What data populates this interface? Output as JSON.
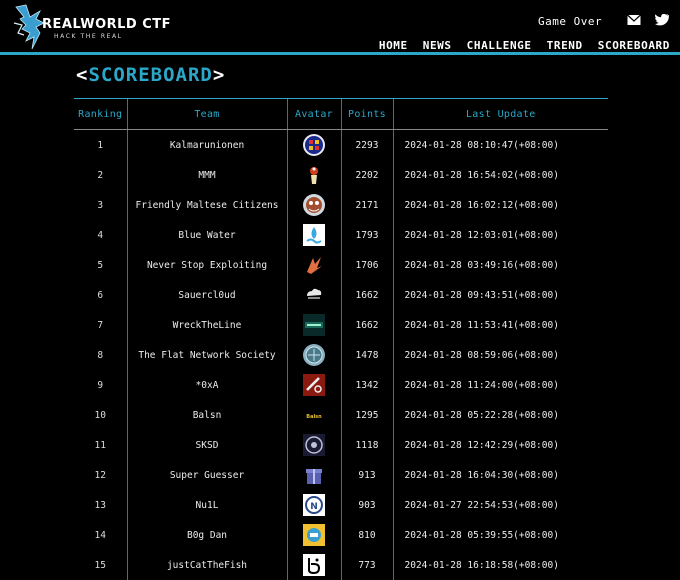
{
  "header": {
    "logo_title": "REALWORLD CTF",
    "logo_sub": "HACK THE REAL",
    "status": "Game Over",
    "icons": [
      "mail-icon",
      "twitter-icon"
    ],
    "nav": [
      {
        "label": "HOME"
      },
      {
        "label": "NEWS"
      },
      {
        "label": "CHALLENGE"
      },
      {
        "label": "TREND"
      },
      {
        "label": "SCOREBOARD"
      }
    ],
    "accent_color": "#2aa7c9"
  },
  "page": {
    "title_open": "<",
    "title": "SCOREBOARD",
    "title_close": ">"
  },
  "table": {
    "columns": [
      "Ranking",
      "Team",
      "Avatar",
      "Points",
      "Last Update"
    ],
    "rows": [
      {
        "rank": "1",
        "team": "Kalmarunionen",
        "avatar": "kalmarunionen-avatar",
        "points": "2293",
        "updated": "2024-01-28 08:10:47(+08:00)"
      },
      {
        "rank": "2",
        "team": "MMM",
        "avatar": "mmm-avatar",
        "points": "2202",
        "updated": "2024-01-28 16:54:02(+08:00)"
      },
      {
        "rank": "3",
        "team": "Friendly Maltese Citizens",
        "avatar": "fmc-avatar",
        "points": "2171",
        "updated": "2024-01-28 16:02:12(+08:00)"
      },
      {
        "rank": "4",
        "team": "Blue Water",
        "avatar": "blue-water-avatar",
        "points": "1793",
        "updated": "2024-01-28 12:03:01(+08:00)"
      },
      {
        "rank": "5",
        "team": "Never Stop Exploiting",
        "avatar": "nse-avatar",
        "points": "1706",
        "updated": "2024-01-28 03:49:16(+08:00)"
      },
      {
        "rank": "6",
        "team": "Sauercl0ud",
        "avatar": "sauercloud-avatar",
        "points": "1662",
        "updated": "2024-01-28 09:43:51(+08:00)"
      },
      {
        "rank": "7",
        "team": "WreckTheLine",
        "avatar": "wrecktheline-avatar",
        "points": "1662",
        "updated": "2024-01-28 11:53:41(+08:00)"
      },
      {
        "rank": "8",
        "team": "The Flat Network Society",
        "avatar": "tfns-avatar",
        "points": "1478",
        "updated": "2024-01-28 08:59:06(+08:00)"
      },
      {
        "rank": "9",
        "team": "*0xA",
        "avatar": "0xa-avatar",
        "points": "1342",
        "updated": "2024-01-28 11:24:00(+08:00)"
      },
      {
        "rank": "10",
        "team": "Balsn",
        "avatar": "balsn-avatar",
        "avatar_text": "Balsn",
        "points": "1295",
        "updated": "2024-01-28 05:22:28(+08:00)"
      },
      {
        "rank": "11",
        "team": "SKSD",
        "avatar": "sksd-avatar",
        "points": "1118",
        "updated": "2024-01-28 12:42:29(+08:00)"
      },
      {
        "rank": "12",
        "team": "Super Guesser",
        "avatar": "super-guesser-avatar",
        "points": "913",
        "updated": "2024-01-28 16:04:30(+08:00)"
      },
      {
        "rank": "13",
        "team": "Nu1L",
        "avatar": "nu1l-avatar",
        "avatar_text": "N",
        "points": "903",
        "updated": "2024-01-27 22:54:53(+08:00)"
      },
      {
        "rank": "14",
        "team": "B0g Dan",
        "avatar": "b0g-dan-avatar",
        "points": "810",
        "updated": "2024-01-28 05:39:55(+08:00)"
      },
      {
        "rank": "15",
        "team": "justCatTheFish",
        "avatar": "justcatthefish-avatar",
        "points": "773",
        "updated": "2024-01-28 16:18:58(+08:00)"
      }
    ]
  }
}
